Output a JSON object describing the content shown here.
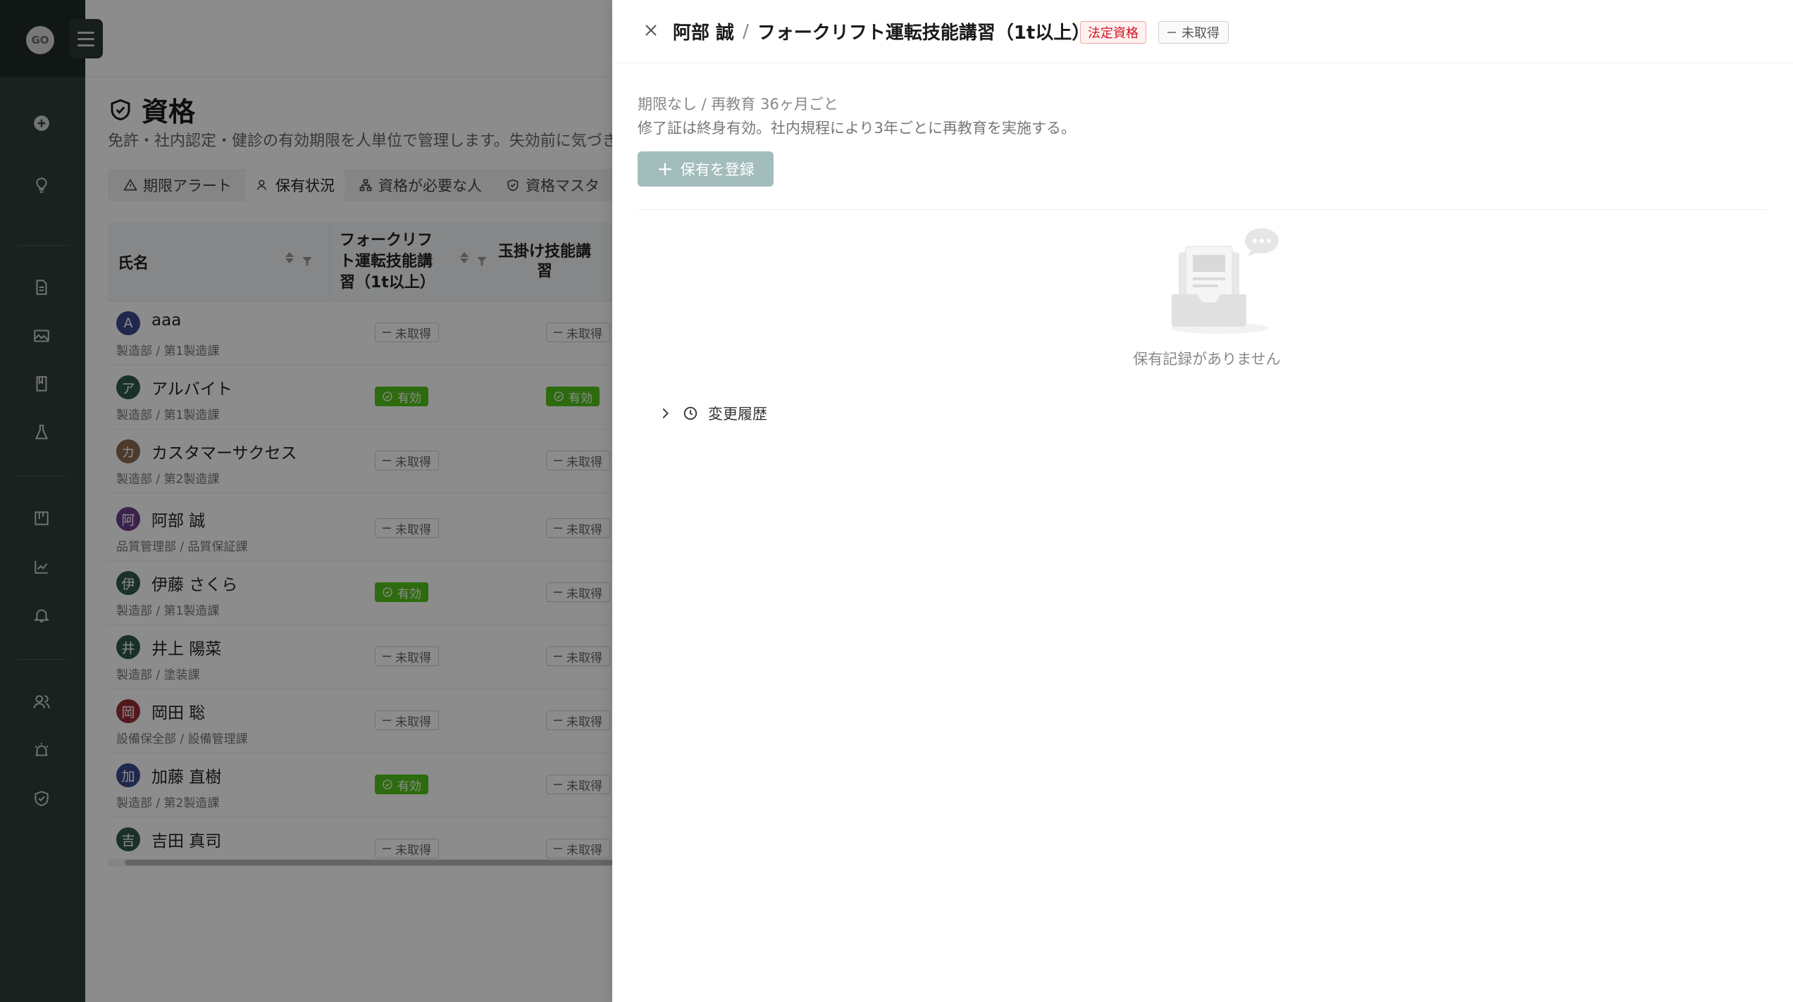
{
  "sidebar": {
    "logo_text": "GO",
    "icons": [
      "plus-circle-icon",
      "lightbulb-icon",
      "document-icon",
      "image-icon",
      "book-icon",
      "flask-icon",
      "kanban-icon",
      "chart-icon",
      "bell-icon",
      "people-icon",
      "alarm-icon",
      "shield-check-icon"
    ]
  },
  "page": {
    "title": "資格",
    "subtitle": "免許・社内認定・健診の有効期限を人単位で管理します。失効前に気づき",
    "tabs": [
      {
        "label": "期限アラート"
      },
      {
        "label": "保有状況"
      },
      {
        "label": "資格が必要な人"
      },
      {
        "label": "資格マスタ"
      }
    ]
  },
  "table": {
    "columns": [
      "氏名",
      "フォークリフト運転技能講習（1t以上）",
      "玉掛け技能講習"
    ],
    "rows": [
      {
        "initial": "A",
        "name": "aaa",
        "dept": "製造部 / 第1製造課",
        "c1": "未取得",
        "c2": "未取得",
        "avatar_color": "#3b4a8f"
      },
      {
        "initial": "ア",
        "name": "アルバイト",
        "dept": "製造部 / 第1製造課",
        "c1": "有効",
        "c2": "有効",
        "avatar_color": "#2f5a4a"
      },
      {
        "initial": "カ",
        "name": "カスタマーサクセス",
        "dept": "製造部 / 第2製造課",
        "c1": "未取得",
        "c2": "未取得",
        "avatar_color": "#8a6b52"
      },
      {
        "initial": "阿",
        "name": "阿部 誠",
        "dept": "品質管理部 / 品質保証課",
        "c1": "未取得",
        "c2": "未取得",
        "avatar_color": "#6a3f8a"
      },
      {
        "initial": "伊",
        "name": "伊藤 さくら",
        "dept": "製造部 / 第1製造課",
        "c1": "有効",
        "c2": "未取得",
        "avatar_color": "#2f5a4a"
      },
      {
        "initial": "井",
        "name": "井上 陽菜",
        "dept": "製造部 / 塗装課",
        "c1": "未取得",
        "c2": "未取得",
        "avatar_color": "#2f5a4a"
      },
      {
        "initial": "岡",
        "name": "岡田 聡",
        "dept": "設備保全部 / 設備管理課",
        "c1": "未取得",
        "c2": "未取得",
        "avatar_color": "#9a2f3a"
      },
      {
        "initial": "加",
        "name": "加藤 直樹",
        "dept": "製造部 / 第2製造課",
        "c1": "有効",
        "c2": "未取得",
        "avatar_color": "#3b4a8f"
      },
      {
        "initial": "吉",
        "name": "吉田 真司",
        "dept": "",
        "c1": "未取得",
        "c2": "未取得",
        "avatar_color": "#2f5a4a"
      }
    ]
  },
  "drawer": {
    "person": "阿部 誠",
    "separator": "/",
    "qualification": "フォークリフト運転技能講習（1t以上）",
    "tag_legal": "法定資格",
    "tag_status": "未取得",
    "meta": "期限なし / 再教育 36ヶ月ごと",
    "description": "修了証は終身有効。社内規程により3年ごとに再教育を実施する。",
    "register_label": "保有を登録",
    "empty_text": "保有記録がありません",
    "history_label": "変更履歴"
  },
  "colors": {
    "sidebar_bg": "#2f3e39",
    "valid_green": "#52c41a",
    "legal_red": "#cf1322",
    "register_btn": "#a3bcbc"
  }
}
